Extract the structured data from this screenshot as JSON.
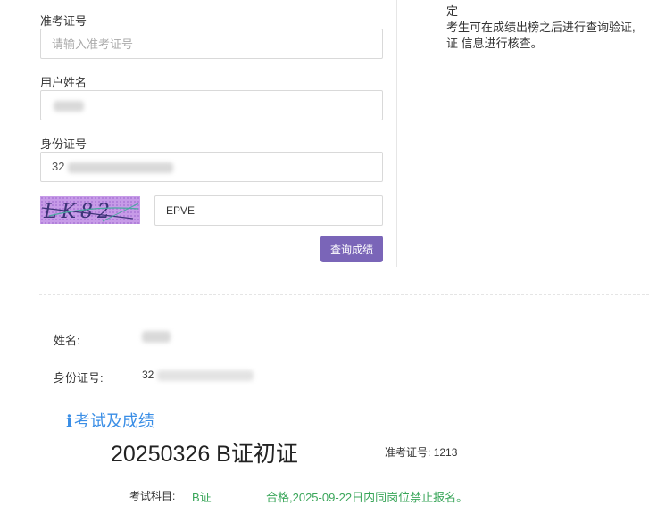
{
  "form": {
    "admission_label": "准考证号",
    "admission_placeholder": "请输入准考证号",
    "name_label": "用户姓名",
    "idcard_label": "身份证号",
    "idcard_value_prefix": "32",
    "captcha_text": "LK82",
    "captcha_value": "EPVE",
    "query_button": "查询成绩"
  },
  "notice": {
    "lines": [
      "定",
      "考生可在成绩出榜之后进行查询验证,",
      "证 信息进行核查。"
    ]
  },
  "result": {
    "name_label": "姓名:",
    "idcard_label": "身份证号:",
    "idcard_prefix": "32",
    "section_title": "考试及成绩",
    "exam_name": "20250326 B证初证",
    "ticket_label": "准考证号:",
    "ticket_value": "1213",
    "subject_label": "考试科目:",
    "subject_value": "B证",
    "result_text": "合格,2025-09-22日内同岗位禁止报名。"
  },
  "colors": {
    "accent_button": "#7a65b8",
    "section_title": "#3a8ee6",
    "pass_green": "#3aa65a"
  },
  "icons": {
    "section_icon": "info-icon"
  }
}
